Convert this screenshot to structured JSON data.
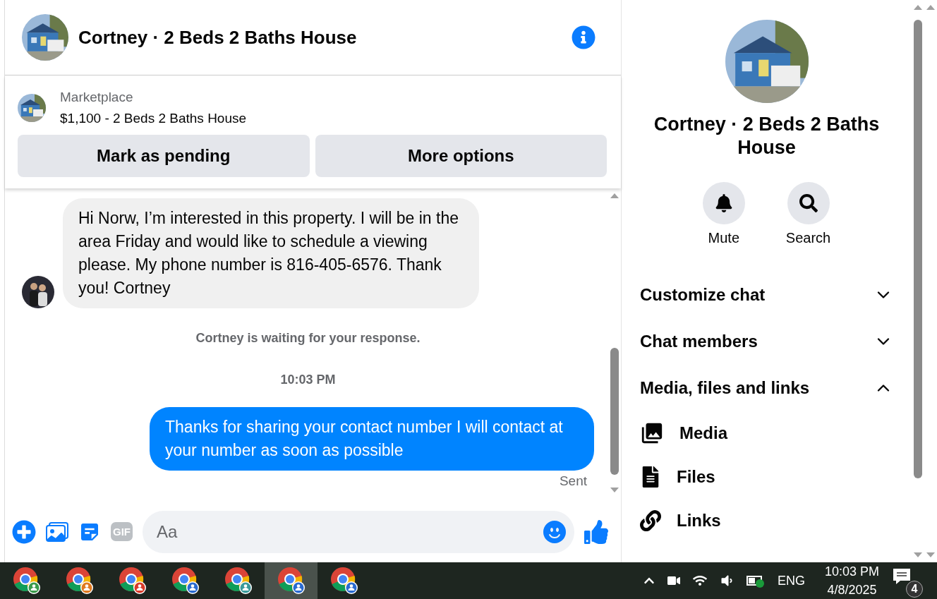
{
  "header": {
    "title": "Cortney · 2 Beds 2 Baths House"
  },
  "listing": {
    "label": "Marketplace",
    "title": "$1,100 - 2 Beds 2 Baths House",
    "buttons": [
      "Mark as pending",
      "More options"
    ]
  },
  "messages": [
    {
      "kind": "incoming",
      "text": "Hi Norw, I’m interested in this property. I will be in the area Friday and would like to schedule a viewing please. My phone number is 816-405-6576. Thank you! Cortney"
    },
    {
      "kind": "notice",
      "text": "Cortney is waiting for your response."
    },
    {
      "kind": "timestamp",
      "text": "10:03 PM"
    },
    {
      "kind": "outgoing",
      "text": "Thanks for sharing your contact number I will contact at your number as soon as possible",
      "status": "Sent"
    }
  ],
  "composer": {
    "gif_label": "GIF",
    "placeholder": "Aa"
  },
  "details": {
    "title": "Cortney · 2 Beds 2 Baths House",
    "actions": [
      {
        "kind": "bell",
        "label": "Mute"
      },
      {
        "kind": "search",
        "label": "Search"
      }
    ],
    "sections": [
      {
        "label": "Customize chat",
        "expanded": false
      },
      {
        "label": "Chat members",
        "expanded": false
      },
      {
        "label": "Media, files and links",
        "expanded": true
      }
    ],
    "items": [
      {
        "kind": "media",
        "label": "Media"
      },
      {
        "kind": "files",
        "label": "Files"
      },
      {
        "kind": "links",
        "label": "Links"
      }
    ]
  },
  "taskbar": {
    "apps": [
      {
        "color": "#3a9a4a",
        "selected": false
      },
      {
        "color": "#e07a20",
        "selected": false
      },
      {
        "color": "#d93a2a",
        "selected": false
      },
      {
        "color": "#2a6ad0",
        "selected": false
      },
      {
        "color": "#3a9a9a",
        "selected": false
      },
      {
        "color": "#2a6ad0",
        "selected": true
      },
      {
        "color": "#2a6ad0",
        "selected": false
      }
    ],
    "language": "ENG",
    "time": "10:03 PM",
    "date": "4/8/2025",
    "notifications": "4"
  }
}
